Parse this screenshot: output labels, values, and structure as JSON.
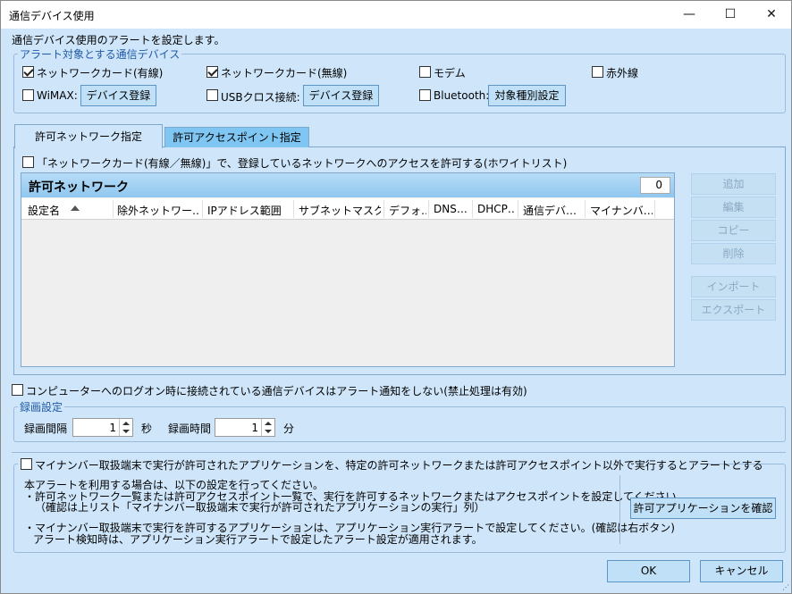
{
  "window": {
    "title": "通信デバイス使用",
    "minimize": "—",
    "maximize": "☐",
    "close": "✕"
  },
  "description": "通信デバイス使用のアラートを設定します。",
  "devices_group": {
    "legend": "アラート対象とする通信デバイス",
    "wired_nic": "ネットワークカード(有線)",
    "wireless_nic": "ネットワークカード(無線)",
    "modem": "モデム",
    "infrared": "赤外線",
    "wimax": "WiMAX:",
    "wimax_button": "デバイス登録",
    "usb_cross": "USBクロス接続:",
    "usb_button": "デバイス登録",
    "bluetooth": "Bluetooth:",
    "bluetooth_button": "対象種別設定"
  },
  "tabs": {
    "allowed_network": "許可ネットワーク指定",
    "allowed_ap": "許可アクセスポイント指定"
  },
  "whitelist_checkbox": "「ネットワークカード(有線／無線)」で、登録しているネットワークへのアクセスを許可する(ホワイトリスト)",
  "network_list": {
    "title": "許可ネットワーク",
    "count": "0",
    "columns": [
      "設定名",
      "除外ネットワー…",
      "IPアドレス範囲",
      "サブネットマスク",
      "デフォ…",
      "DNS…",
      "DHCP…",
      "通信デバ…",
      "マイナンバ…"
    ]
  },
  "side_buttons": {
    "add": "追加",
    "edit": "編集",
    "copy": "コピー",
    "delete": "削除",
    "import": "インポート",
    "export": "エクスポート"
  },
  "logon_checkbox": "コンピューターへのログオン時に接続されている通信デバイスはアラート通知をしない(禁止処理は有効)",
  "recording": {
    "legend": "録画設定",
    "interval_label": "録画間隔",
    "interval_value": "1",
    "interval_unit": "秒",
    "duration_label": "録画時間",
    "duration_value": "1",
    "duration_unit": "分"
  },
  "mynumber": {
    "checkbox": "マイナンバー取扱端末で実行が許可されたアプリケーションを、特定の許可ネットワークまたは許可アクセスポイント以外で実行するとアラートとする",
    "note1": "本アラートを利用する場合は、以下の設定を行ってください。",
    "note2": "・許可ネットワーク一覧または許可アクセスポイント一覧で、実行を許可するネットワークまたはアクセスポイントを設定してください。",
    "note3": "（確認は上リスト「マイナンバー取扱端末で実行が許可されたアプリケーションの実行」列）",
    "note4": "・マイナンバー取扱端末で実行を許可するアプリケーションは、アプリケーション実行アラートで設定してください。(確認は右ボタン)",
    "note5": "アラート検知時は、アプリケーション実行アラートで設定したアラート設定が適用されます。",
    "check_button": "許可アプリケーションを確認"
  },
  "footer": {
    "ok": "OK",
    "cancel": "キャンセル"
  }
}
